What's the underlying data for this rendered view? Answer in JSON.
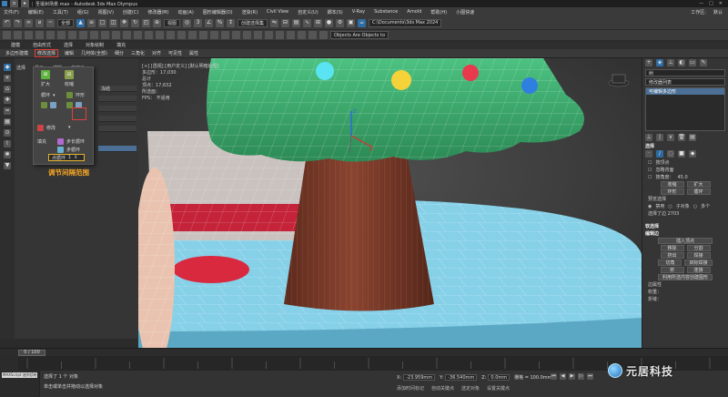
{
  "title": {
    "text": "圣诞树场景.max - Autodesk 3ds Max Olympus",
    "controls": [
      "—",
      "□",
      "✕"
    ]
  },
  "menubar": {
    "items": [
      "文件(F)",
      "编辑(E)",
      "工具(T)",
      "组(G)",
      "视图(V)",
      "创建(C)",
      "修改器(M)",
      "动画(A)",
      "图形编辑器(D)",
      "渲染(R)",
      "Civil View",
      "自定义(U)",
      "脚本(S)",
      "V-Ray",
      "Substance",
      "Arnold",
      "帮助(H)",
      "小图快速"
    ],
    "workspace_label": "工作区:",
    "workspace_value": "默认"
  },
  "toolbar": {
    "view_dropdown": "全部",
    "selection_set_dropdown": "创建选择集",
    "path_dropdown": "C:\\Documents\\3ds Max 2024",
    "object_dropdown": "Objects Are Objects to"
  },
  "ribbon": {
    "tabs": [
      "建模",
      "自由形式",
      "选择",
      "对象绘制",
      "填充"
    ],
    "row_items": [
      "多边形建模",
      "修改选择",
      "编辑",
      "几何体(全部)",
      "细分",
      "三角化",
      "对齐",
      "可见性",
      "属性"
    ],
    "active_item": "修改选择"
  },
  "scene_explorer": {
    "header": [
      "选择",
      "显示",
      "编辑",
      "自定义"
    ],
    "rows": [
      "冻结",
      "",
      "",
      "",
      "",
      ""
    ],
    "selected_row_index": 5
  },
  "popup": {
    "top_buttons": [
      {
        "label": "扩大"
      },
      {
        "label": "收缩"
      }
    ],
    "labels": [
      "循环",
      "环形",
      "对齐",
      "增长",
      "修改",
      "循环模式",
      "显示",
      "步长循环",
      "步循环"
    ],
    "loop_mode_label": "循环",
    "ring_label": "环形",
    "modify_label": "修改",
    "step_loop_label": "步长循环",
    "step_loop2_label": "步循环",
    "display_label": "填充",
    "spinner_label": "点循环",
    "spinner_value": "1"
  },
  "annotation": {
    "text": "调节间隔范围"
  },
  "viewport": {
    "label_lines": [
      "[+] [透视] [用户定义] [默认明暗处理]",
      "多边形：17,030",
      "总计",
      "顶点：17,632",
      "所选面：",
      "FPS：    不适用"
    ]
  },
  "command_panel": {
    "object_name": "树",
    "modifier_list": "修改器列表",
    "stack_item": "可编辑多边形",
    "selection_section": "选择",
    "by_vertex": "按顶点",
    "ignore_backfacing": "忽略背面",
    "by_angle": "按角度：",
    "angle_value": "45.0",
    "shrink": "收缩",
    "grow": "扩大",
    "ring": "环形",
    "loop": "循环",
    "preview_selection": "预览选择",
    "off": "禁用",
    "sub_object": "子对象",
    "multi": "多个",
    "selected_edges": "选择了边 2703",
    "soft_selection": "软选择",
    "edit_edges": "编辑边",
    "insert_vertex": "插入顶点",
    "remove": "移除",
    "split": "分割",
    "extrude": "挤出",
    "weld": "焊接",
    "chamfer": "切角",
    "target_weld": "目标焊接",
    "bridge": "桥",
    "connect": "连接",
    "create_shape": "利用所选内容创建图形",
    "edge_properties": "边属性",
    "weight": "权重：",
    "crease": "折缝："
  },
  "timeline": {
    "frame": "0 / 100"
  },
  "status": {
    "maxscript": "MAXScript 迷你侦听器",
    "line1": "选择了 1 个 对象",
    "line2": "单击或单击并拖动以选择对象",
    "coord_x_label": "X:",
    "coord_x": "-23.959mm",
    "coord_y_label": "Y:",
    "coord_y": "-36.540mm",
    "coord_z_label": "Z:",
    "coord_z": "0.0mm",
    "grid_label": "栅格 = 100.0mm",
    "add_time_tag": "添加时间标记",
    "auto_key": "自动关键点",
    "set_key": "设置关键点",
    "selected": "选定对象"
  },
  "logo": {
    "text": "元居科技"
  },
  "colors": {
    "accent_blue": "#4b6f95",
    "highlight_red": "#e0413b",
    "annotation_orange": "#f4a524",
    "tree_green": "#3fae6e",
    "trunk_brown": "#7a3a26",
    "ground_cyan": "#86d0e8"
  }
}
